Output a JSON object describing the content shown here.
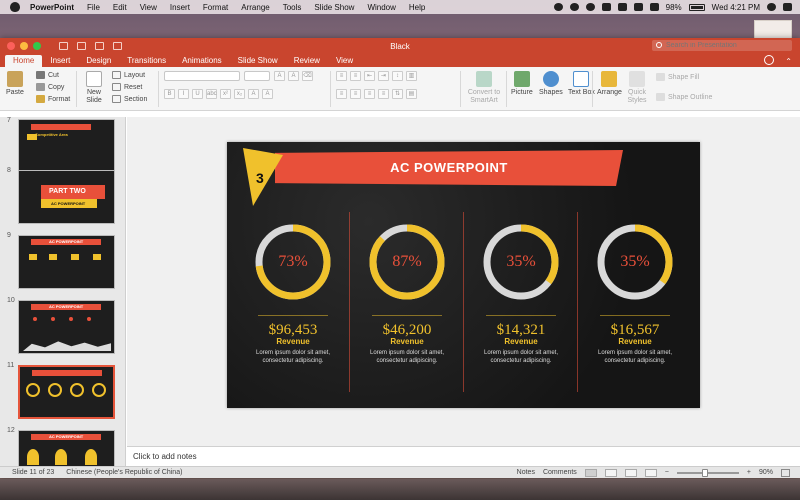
{
  "menubar": {
    "app_name": "PowerPoint",
    "items": [
      "File",
      "Edit",
      "View",
      "Insert",
      "Format",
      "Arrange",
      "Tools",
      "Slide Show",
      "Window",
      "Help"
    ],
    "battery": "98%",
    "clock": "Wed 4:21 PM",
    "icons": [
      "apple-icon",
      "hat-icon",
      "cat-icon",
      "qq-icon",
      "chat-icon",
      "wifi-icon",
      "shazam-icon",
      "volume-icon",
      "battery-icon",
      "search-icon",
      "list-icon"
    ]
  },
  "window": {
    "doc_title": "Black",
    "search_placeholder": "Search in Presentation"
  },
  "tabs": [
    "Home",
    "Insert",
    "Design",
    "Transitions",
    "Animations",
    "Slide Show",
    "Review",
    "View"
  ],
  "active_tab": "Home",
  "ribbon": {
    "paste": "Paste",
    "cut": "Cut",
    "copy": "Copy",
    "format": "Format",
    "new_slide": "New Slide",
    "layout": "Layout",
    "reset": "Reset",
    "section": "Section",
    "convert_smartart": "Convert to SmartArt",
    "picture": "Picture",
    "shapes": "Shapes",
    "text_box": "Text Box",
    "arrange": "Arrange",
    "quick_styles": "Quick Styles",
    "shape_fill": "Shape Fill",
    "shape_outline": "Shape Outline",
    "format_buttons": [
      "B",
      "I",
      "U",
      "abc",
      "x²",
      "x₂"
    ]
  },
  "thumbnails": [
    {
      "num": "7",
      "label": "Competitive Area"
    },
    {
      "num": "8",
      "label": "PART TWO",
      "sub": "AC POWERPOINT"
    },
    {
      "num": "9",
      "label": "AC POWERPOINT"
    },
    {
      "num": "10",
      "label": "AC POWERPOINT"
    },
    {
      "num": "11",
      "label": ""
    },
    {
      "num": "12",
      "label": "AC POWERPOINT"
    }
  ],
  "selected_slide": "11",
  "slide": {
    "number": "3",
    "title": "AC POWERPOINT",
    "metrics": [
      {
        "percent": "73%",
        "fraction": 0.73,
        "amount": "$96,453",
        "label": "Revenue",
        "desc": "Lorem ipsum dolor sit amet, consectetur adipiscing."
      },
      {
        "percent": "87%",
        "fraction": 0.87,
        "amount": "$46,200",
        "label": "Revenue",
        "desc": "Lorem ipsum dolor sit amet, consectetur adipiscing."
      },
      {
        "percent": "35%",
        "fraction": 0.35,
        "amount": "$14,321",
        "label": "Revenue",
        "desc": "Lorem ipsum dolor sit amet, consectetur adipiscing."
      },
      {
        "percent": "35%",
        "fraction": 0.35,
        "amount": "$16,567",
        "label": "Revenue",
        "desc": "Lorem ipsum dolor sit amet, consectetur adipiscing."
      }
    ]
  },
  "notes_placeholder": "Click to add notes",
  "status": {
    "slide_count": "Slide 11 of 23",
    "language": "Chinese (People's Republic of China)",
    "notes": "Notes",
    "comments": "Comments",
    "zoom": "90%",
    "zoom_fraction": 0.45
  },
  "colors": {
    "accent_red": "#e8503a",
    "accent_yellow": "#f0c12c",
    "ribbon_red": "#c9452e"
  }
}
